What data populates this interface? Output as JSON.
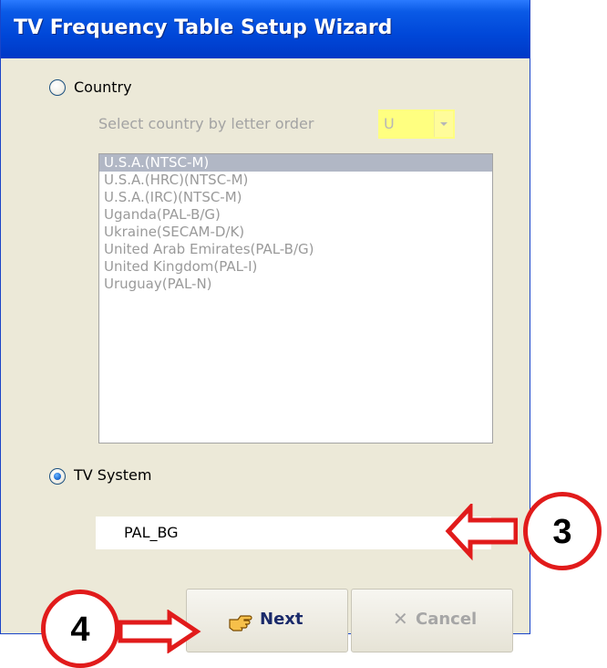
{
  "window": {
    "title": "TV Frequency Table Setup Wizard"
  },
  "country_option": {
    "label": "Country",
    "selected": false,
    "letter_prompt": "Select country by letter order",
    "letter_value": "U"
  },
  "country_list": {
    "items": [
      "U.S.A.(NTSC-M)",
      "U.S.A.(HRC)(NTSC-M)",
      "U.S.A.(IRC)(NTSC-M)",
      "Uganda(PAL-B/G)",
      "Ukraine(SECAM-D/K)",
      "United Arab Emirates(PAL-B/G)",
      "United Kingdom(PAL-I)",
      "Uruguay(PAL-N)"
    ],
    "selected_index": 0
  },
  "tv_system_option": {
    "label": "TV System",
    "selected": true,
    "value": "PAL_BG"
  },
  "buttons": {
    "next_label": "Next",
    "cancel_label": "Cancel"
  },
  "callouts": {
    "tv_system": "3",
    "next": "4"
  },
  "colors": {
    "callout_red": "#e11b1b",
    "titlebar_blue": "#0047d8",
    "combo_yellow": "#ffff80"
  }
}
